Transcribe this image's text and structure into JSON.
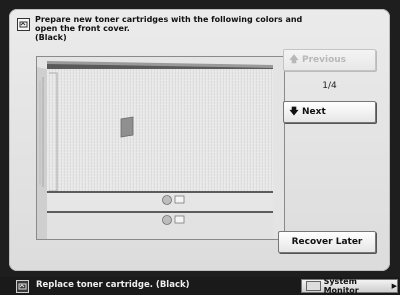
{
  "dialog": {
    "message_lines": "Prepare new toner cartridges with the following colors and\nopen the front cover.\n(Black)",
    "icon": "message-icon"
  },
  "navigation": {
    "previous_label": "Previous",
    "next_label": "Next",
    "page_indicator": "1/4",
    "previous_enabled": false
  },
  "actions": {
    "recover_later_label": "Recover Later"
  },
  "status_bar": {
    "message": "Replace toner cartridge. (Black)",
    "system_monitor_label": "System Monitor"
  },
  "colors": {
    "panel_bg": "#e4e4e4",
    "status_bar_bg": "#1a1a1a",
    "disabled_text": "#b8b8b8"
  }
}
